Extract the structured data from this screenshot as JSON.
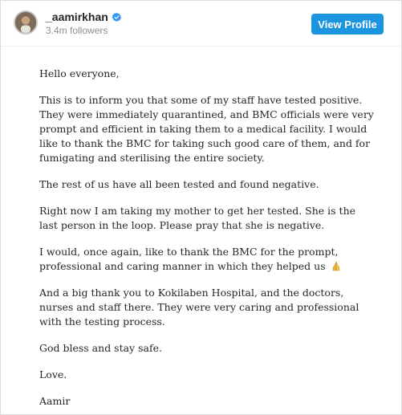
{
  "header": {
    "username": "_aamirkhan",
    "followers": "3.4m followers",
    "view_profile_label": "View Profile",
    "verified_color": "#3897f0",
    "button_color": "#1b95e0"
  },
  "post": {
    "greeting": "Hello everyone,",
    "p1": "This is to inform you that some of my staff have tested positive. They were immediately quarantined, and BMC officials were very prompt and efficient in taking them to a medical facility. I would like to thank the BMC for taking such good care of them, and for fumigating and sterilising the entire society.",
    "p2": "The rest of us have all been tested and found negative.",
    "p3": "Right now I am taking my mother to get her tested. She is the last person in the loop. Please pray that she is negative.",
    "p4": "I would, once again, like to thank the BMC for the prompt, professional and caring manner in which they helped us",
    "p4_icon": "folded-hands-icon",
    "p5": "And a big thank you to Kokilaben Hospital, and the doctors, nurses and staff there. They were very caring and professional with the testing process.",
    "p6": "God bless and stay safe.",
    "p7": "Love.",
    "signature": "Aamir"
  }
}
